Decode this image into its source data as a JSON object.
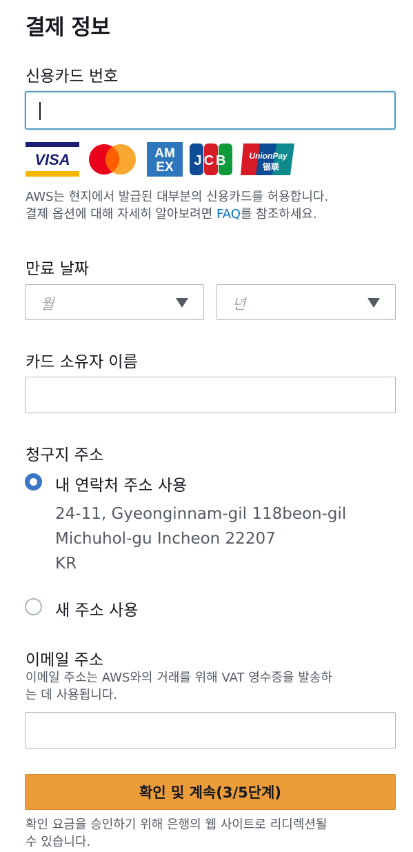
{
  "page": {
    "title": "결제 정보"
  },
  "card_number": {
    "label": "신용카드 번호",
    "value": ""
  },
  "card_brands": {
    "visa": "VISA",
    "amex_top": "AM",
    "amex_bottom": "EX",
    "jcb": "JCB",
    "unionpay": "UnionPay",
    "unionpay_cn": "银联"
  },
  "card_help": {
    "line1": "AWS는 현지에서 발급된 대부분의 신용카드를 허용합니다.",
    "line2_prefix": "결제 옵션에 대해 자세히 알아보려면 ",
    "faq_link": "FAQ",
    "line2_suffix": "를 참조하세요."
  },
  "expiry": {
    "label": "만료 날짜",
    "month_placeholder": "월",
    "year_placeholder": "년"
  },
  "cardholder": {
    "label": "카드 소유자 이름",
    "value": ""
  },
  "billing": {
    "label": "청구지 주소",
    "option_contact": "내 연락처 주소 사용",
    "address_line1": "24-11, Gyeonginnam-gil 118beon-gil",
    "address_line2": "Michuhol-gu Incheon 22207",
    "address_line3": "KR",
    "option_new": "새 주소 사용"
  },
  "email": {
    "label": "이메일 주소",
    "help_line1": "이메일 주소는 AWS와의 거래를 위해 VAT 영수증을 발송하",
    "help_line2": "는 데 사용됩니다.",
    "value": ""
  },
  "submit": {
    "label": "확인 및 계속(3/5단계)",
    "note_line1": "확인 요금을 승인하기 위해 은행의 웹 사이트로 리디렉션될",
    "note_line2": "수 있습니다."
  },
  "colors": {
    "accent": "#ec9d3a",
    "link": "#0073bb",
    "radio_selected": "#3c74c7",
    "focus_border": "#5a9ec2"
  }
}
